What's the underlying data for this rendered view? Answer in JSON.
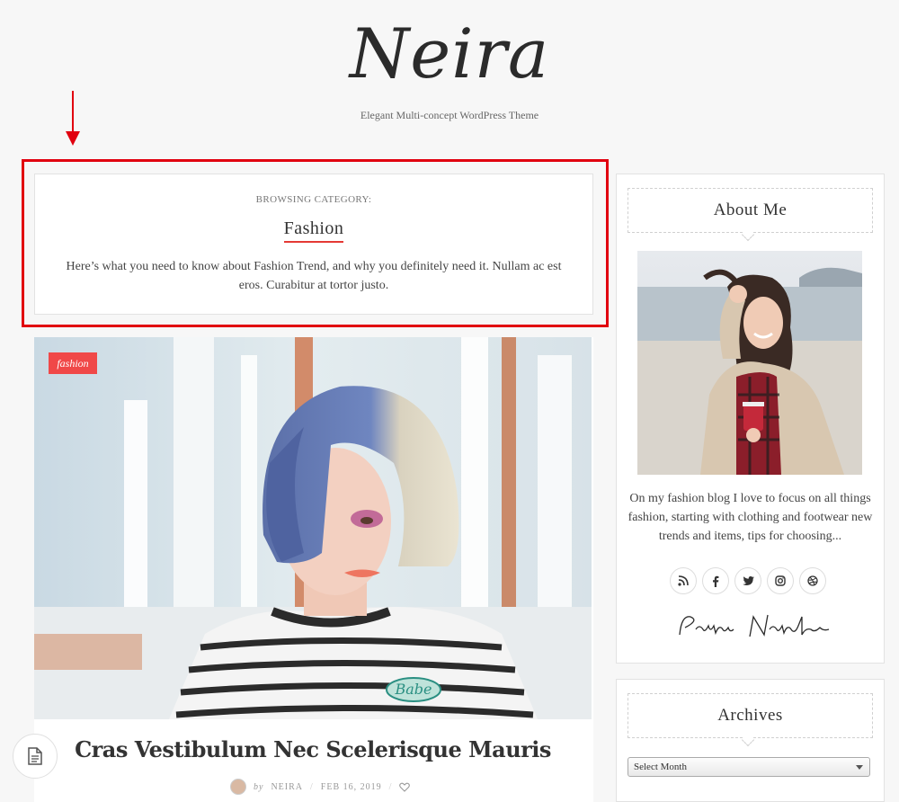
{
  "header": {
    "site_title": "Neira",
    "tagline": "Elegant Multi-concept WordPress Theme"
  },
  "category": {
    "pre_label": "BROWSING CATEGORY:",
    "name": "Fashion",
    "description": "Here’s what you need to know about Fashion Trend, and why you definitely need it. Nullam ac est eros. Curabitur at tortor justo."
  },
  "post": {
    "tag": "fashion",
    "title": "Cras Vestibulum Nec Scelerisque Mauris",
    "author_prefix": "by",
    "author": "NEIRA",
    "separator": "/",
    "date": "FEB 16, 2019",
    "image_alt": "Woman with blue and blonde bob haircut in striped shirt",
    "shirt_text": "Babe"
  },
  "sidebar": {
    "about": {
      "title": "About Me",
      "text": "On my fashion blog I love to focus on all things fashion, starting with clothing and footwear new trends and items, tips for choosing...",
      "social_icons": [
        "rss-icon",
        "facebook-icon",
        "twitter-icon",
        "instagram-icon",
        "dribbble-icon"
      ],
      "signature": "Patricia Nanette"
    },
    "archives": {
      "title": "Archives",
      "select_value": "Select Month"
    }
  },
  "colors": {
    "accent": "#f04848",
    "annotation": "#e1000f",
    "background": "#f7f7f7"
  }
}
